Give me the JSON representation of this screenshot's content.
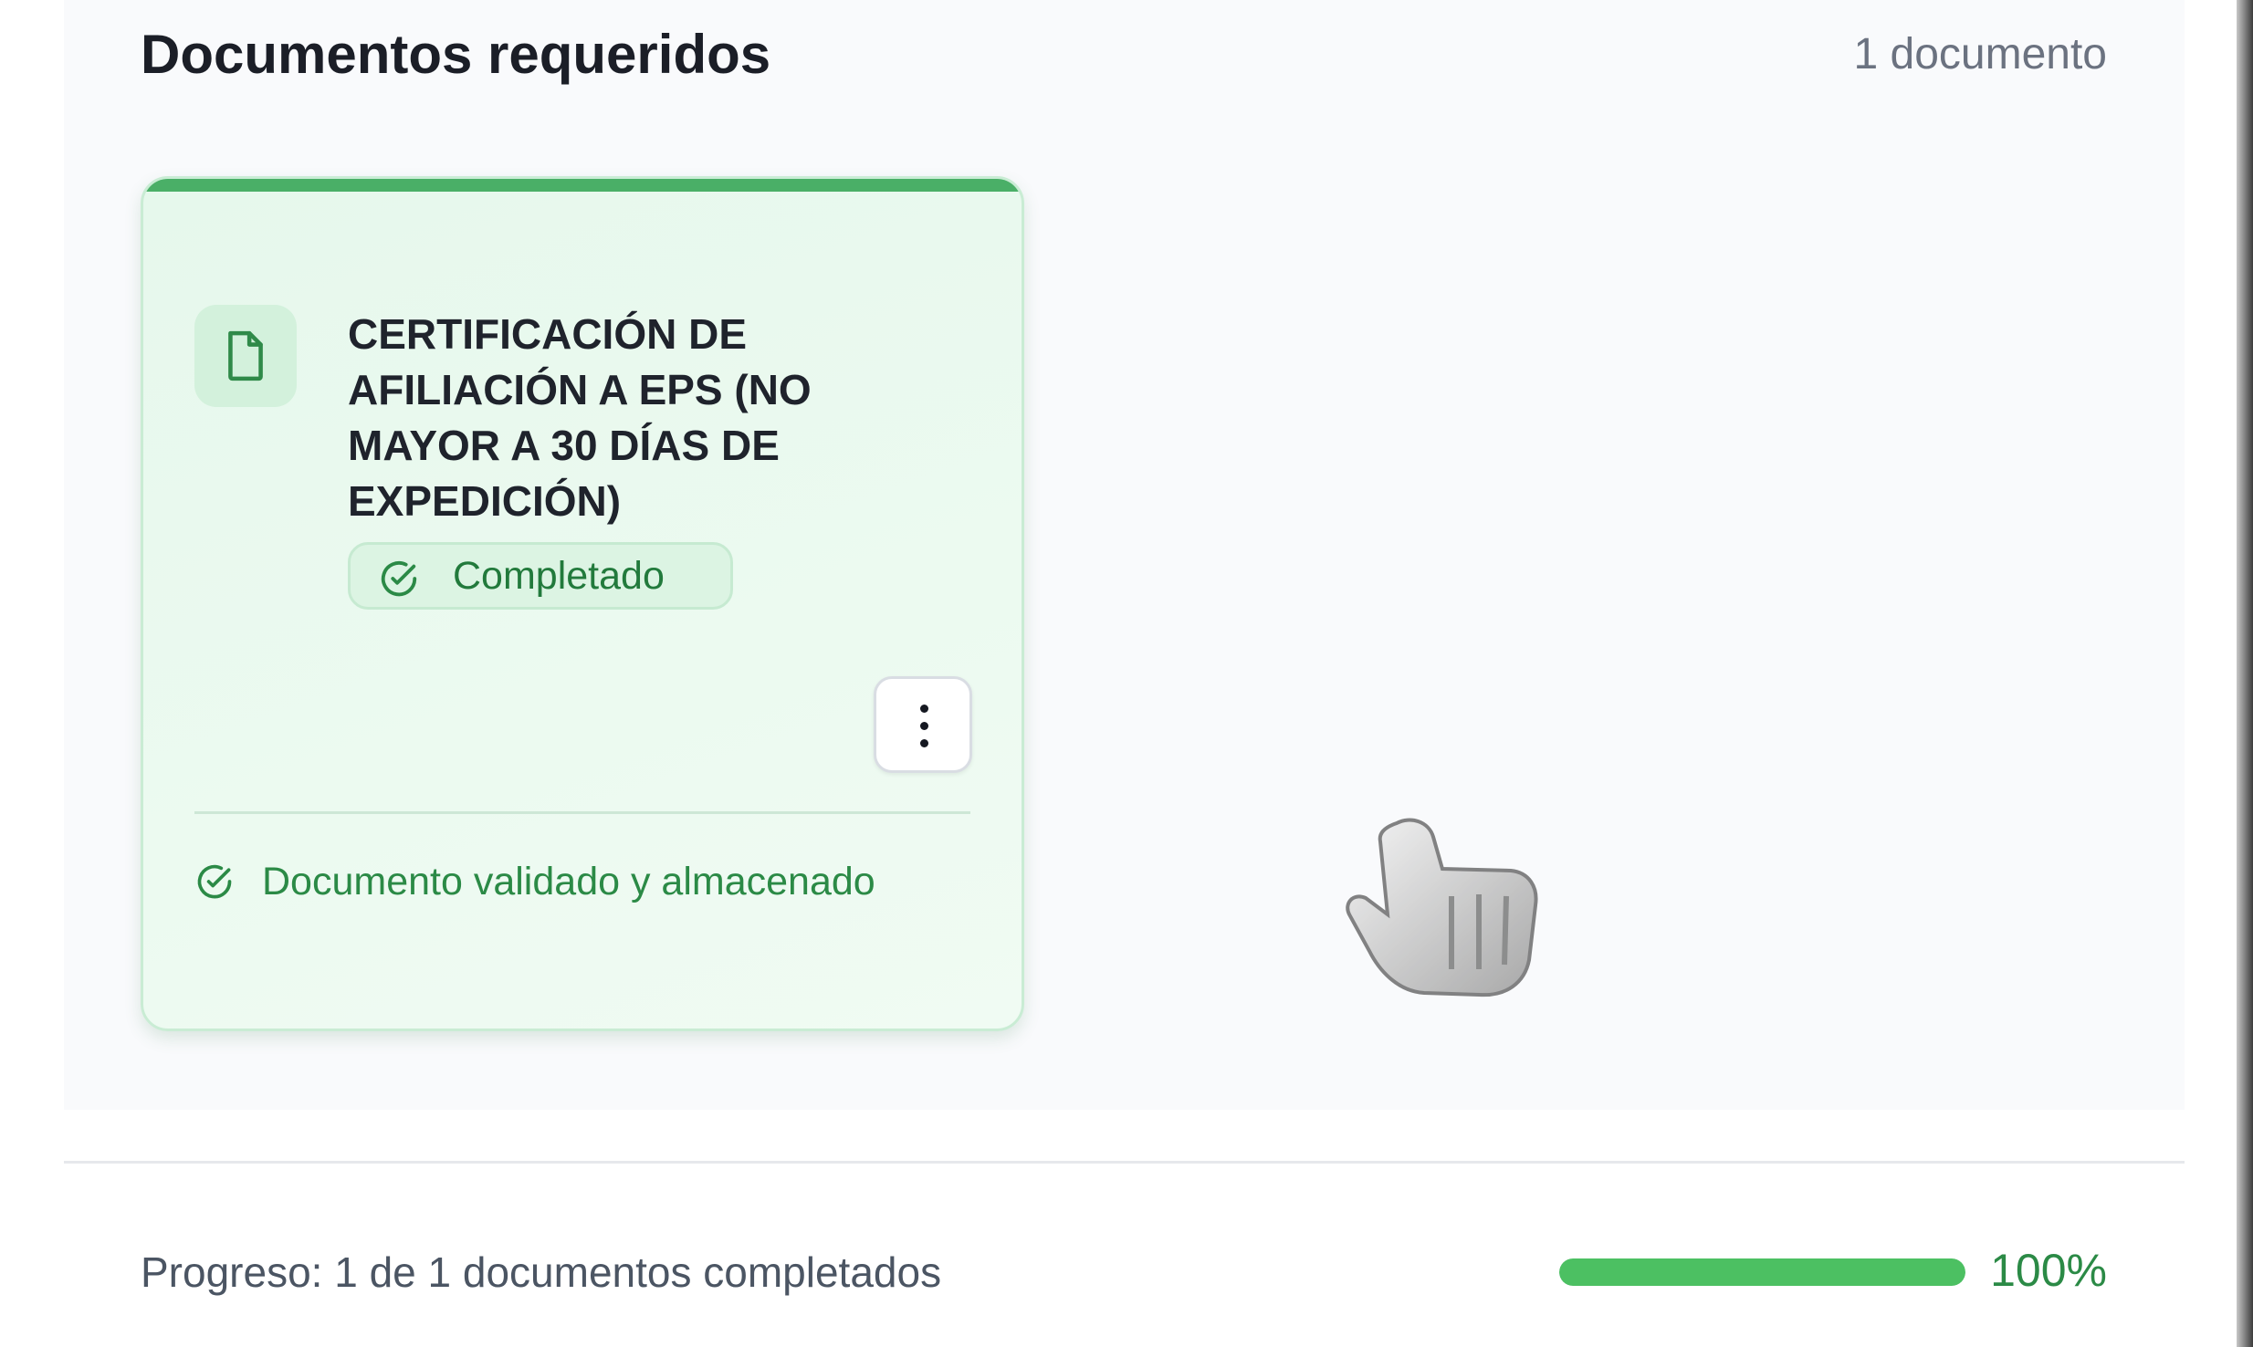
{
  "header": {
    "title": "Documentos requeridos",
    "count": "1 documento"
  },
  "document": {
    "title": "CERTIFICACIÓN DE AFILIACIÓN A EPS (NO MAYOR A 30 DÍAS DE EXPEDICIÓN)",
    "status": "Completado",
    "footer": "Documento validado y almacenado",
    "icon": "file-icon",
    "menu_icon": "more-vertical-icon",
    "accent_color": "#4aaf67"
  },
  "progress": {
    "label": "Progreso: 1 de 1 documentos completados",
    "percent_text": "100%",
    "value": 100,
    "bar_color": "#4cc062"
  }
}
